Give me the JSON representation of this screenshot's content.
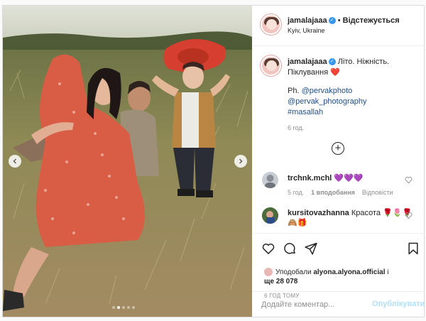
{
  "post": {
    "author": "jamalajaaa",
    "follow_separator": "•",
    "follow_status": "Відстежується",
    "location": "Kyiv, Ukraine"
  },
  "caption": {
    "author": "jamalajaaa",
    "text": "Літо. Ніжність. Піклування",
    "emoji": "❤️",
    "photo_credit_prefix": "Ph.",
    "mention_1": "@pervakphoto",
    "mention_2": "@pervak_photography",
    "hashtag": "#masallah",
    "time": "6 год."
  },
  "comments": [
    {
      "author": "trchnk.mchl",
      "text": "💜💜💜",
      "time": "5 год.",
      "likes": "1 вподобання",
      "reply": "Відповісти"
    },
    {
      "author": "kursitovazhanna",
      "text": "Красота 🌹🌷🌹",
      "emoji_line": "🙈🎁"
    }
  ],
  "likes": {
    "prefix": "Уподобали",
    "user": "alyona.alyona.official",
    "and": "і",
    "others": "ще 28 078"
  },
  "post_date": "6 ГОД ТОМУ",
  "add_comment": {
    "placeholder": "Додайте коментар...",
    "button": "Опублікувати"
  },
  "carousel": {
    "total_slides": 5,
    "active_slide": 2
  },
  "icons": [
    "heart-icon",
    "comment-icon",
    "share-icon",
    "bookmark-icon",
    "verified-icon",
    "plus-circle-icon",
    "chevron-left-icon",
    "chevron-right-icon"
  ]
}
